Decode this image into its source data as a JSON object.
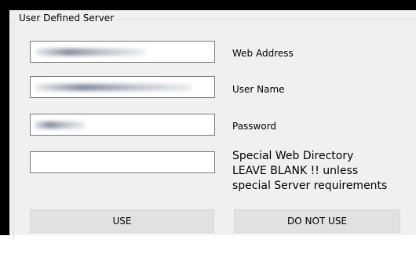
{
  "group": {
    "title": "User Defined Server"
  },
  "fields": {
    "web_address": {
      "label": "Web Address",
      "value": ""
    },
    "user_name": {
      "label": "User Name",
      "value": ""
    },
    "password": {
      "label": "Password",
      "value": ""
    },
    "special_dir": {
      "label_lines": [
        "Special Web Directory",
        "LEAVE BLANK !! unless",
        "special Server requirements"
      ],
      "value": ""
    }
  },
  "buttons": {
    "use": "USE",
    "do_not_use": "DO NOT USE"
  },
  "colors": {
    "window_frame": "#000000",
    "dialog_background": "#f0f0f0",
    "button_face": "#e1e1e1"
  }
}
